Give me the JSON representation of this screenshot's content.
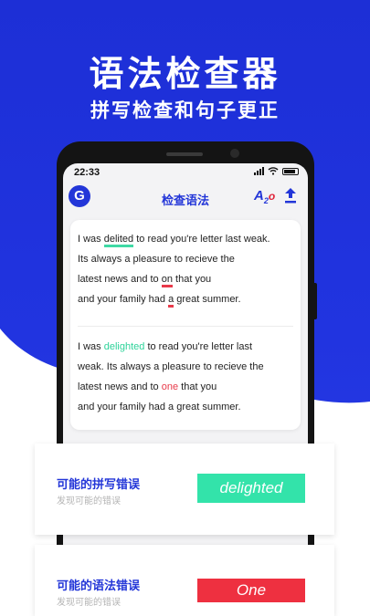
{
  "promo": {
    "headline": "语法检查器",
    "subheadline": "拼写检查和句子更正"
  },
  "status_bar": {
    "time": "22:33"
  },
  "app_bar": {
    "logo_letter": "G",
    "title": "检查语法",
    "a2o_a": "A",
    "a2o_2": "2",
    "a2o_o": "o"
  },
  "original_text": {
    "line1_pre": "I was ",
    "line1_err": "delited",
    "line1_post": " to read you're letter last weak.",
    "line2": "Its always a pleasure to recieve the",
    "line3_pre": "latest news and to ",
    "line3_err": "on",
    "line3_post": " that you",
    "line4_pre": "and your family had ",
    "line4_err": "a",
    "line4_post": " great summer."
  },
  "corrected_text": {
    "line1_pre": "I was ",
    "line1_fix": "delighted",
    "line1_post": " to read you're letter last",
    "line2": "weak. Its always a pleasure to recieve the",
    "line3_pre": "latest news and to ",
    "line3_fix": "one",
    "line3_post": " that you",
    "line4": "and your family had a great summer."
  },
  "suggestions": [
    {
      "title": "可能的拼写错误",
      "subtitle": "发现可能的错误",
      "fix": "delighted",
      "color": "#33e3aa"
    },
    {
      "title": "可能的语法错误",
      "subtitle": "发现可能的错误",
      "fix": "One",
      "color": "#ee3040"
    }
  ],
  "colors": {
    "brand": "#2336d8",
    "accent_green": "#3fd9a4",
    "accent_red": "#e83a4a"
  }
}
